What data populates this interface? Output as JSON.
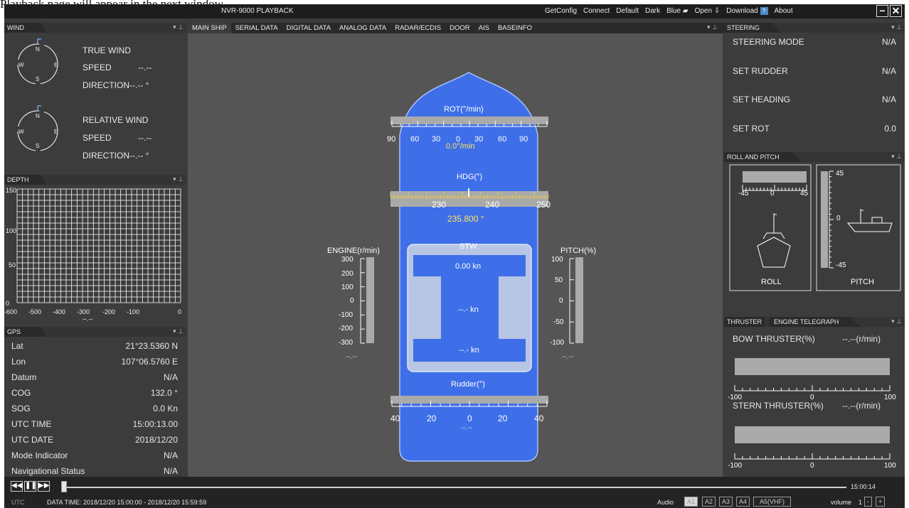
{
  "caption": "Playback page will appear in the next window.",
  "app": {
    "title": "NVR-9000 PLAYBACK",
    "menu": [
      "GetConfig",
      "Connect",
      "Default",
      "Dark",
      "Blue",
      "Open",
      "Download",
      "About"
    ],
    "min_label": "−",
    "close_label": "✕"
  },
  "wind": {
    "tab": "WIND",
    "true_title": "TRUE WIND",
    "true_speed_label": "SPEED",
    "true_speed_value": "--.--",
    "true_dir_label": "DIRECTION",
    "true_dir_value": "--.-- °",
    "rel_title": "RELATIVE WIND",
    "rel_speed_label": "SPEED",
    "rel_speed_value": "--.--",
    "rel_dir_label": "DIRECTION",
    "rel_dir_value": "--.-- °",
    "compass": {
      "n": "N",
      "e": "E",
      "s": "S",
      "w": "W"
    }
  },
  "depth": {
    "tab": "DEPTH",
    "y_ticks": [
      "150",
      "100",
      "50",
      "0"
    ],
    "x_ticks": [
      "-600",
      "-500",
      "-400",
      "-300",
      "-200",
      "-100",
      "0"
    ],
    "readout": "--.--"
  },
  "gps": {
    "tab": "GPS",
    "rows": [
      {
        "label": "Lat",
        "value": "21°23.5360 N"
      },
      {
        "label": "Lon",
        "value": "107°06.5760 E"
      },
      {
        "label": "Datum",
        "value": "N/A"
      },
      {
        "label": "COG",
        "value": "132.0 °"
      },
      {
        "label": "SOG",
        "value": "0.0 Kn"
      },
      {
        "label": "UTC TIME",
        "value": "15:00:13.00"
      },
      {
        "label": "UTC DATE",
        "value": "2018/12/20"
      },
      {
        "label": "Mode Indicator",
        "value": "N/A"
      },
      {
        "label": "Navigational Status",
        "value": "N/A"
      }
    ]
  },
  "tabs": [
    "MAIN SHIP",
    "SERIAL DATA",
    "DIGITAL DATA",
    "ANALOG DATA",
    "RADAR/ECDIS",
    "DOOR",
    "AIS",
    "BASEINFO"
  ],
  "ship": {
    "rot_label": "ROT(°/min)",
    "rot_ticks": [
      "90",
      "60",
      "30",
      "0",
      "30",
      "60",
      "90"
    ],
    "rot_value": "0.0°/min",
    "hdg_label": "HDG(°)",
    "hdg_ticks": [
      "230",
      "240",
      "250"
    ],
    "hdg_value": "235.800 °",
    "stw_label": "STW",
    "stw_value": "0.00 kn",
    "mid_value": "--.- kn",
    "bottom_value": "--.- kn",
    "engine_label": "ENGINE(r/min)",
    "engine_ticks": [
      "300",
      "200",
      "100",
      "0",
      "-100",
      "-200",
      "-300"
    ],
    "engine_readout": "--.--",
    "pitch_label": "PITCH(%)",
    "pitch_ticks": [
      "100",
      "50",
      "0",
      "-50",
      "-100"
    ],
    "pitch_readout": "--.--",
    "rudder_label": "Rudder(°)",
    "rudder_ticks": [
      "40",
      "20",
      "0",
      "20",
      "40"
    ],
    "rudder_readout": "--.--"
  },
  "steering": {
    "tab": "STEERING",
    "rows": [
      {
        "label": "STEERING MODE",
        "value": "N/A"
      },
      {
        "label": "SET RUDDER",
        "value": "N/A"
      },
      {
        "label": "SET HEADING",
        "value": "N/A"
      },
      {
        "label": "SET ROT",
        "value": "0.0"
      }
    ]
  },
  "roll_pitch": {
    "tab": "ROLL AND PITCH",
    "roll_ticks": [
      "-45",
      "0",
      "45"
    ],
    "pitch_ticks": [
      "45",
      "0",
      "-45"
    ],
    "roll_label": "ROLL",
    "pitch_label": "PITCH"
  },
  "thruster": {
    "tab1": "THRUSTER",
    "tab2": "ENGINE TELEGRAPH",
    "bow_label": "BOW THRUSTER(%)",
    "bow_value": "--.--(r/min)",
    "stern_label": "STERN THRUSTER(%)",
    "stern_value": "--.--(r/min)",
    "ticks": [
      "-100",
      "0",
      "100"
    ]
  },
  "playback": {
    "time": "15:00:14",
    "tz": "UTC",
    "data_time": "DATA TIME: 2018/12/20 15:00:00 - 2018/12/20 15:59:59",
    "audio_label": "Audio",
    "channels": [
      "A1",
      "A2",
      "A3",
      "A4",
      "A5(VHF)"
    ],
    "volume_label": "volume",
    "volume_value": "1",
    "vol_minus": "-",
    "vol_plus": "+"
  }
}
